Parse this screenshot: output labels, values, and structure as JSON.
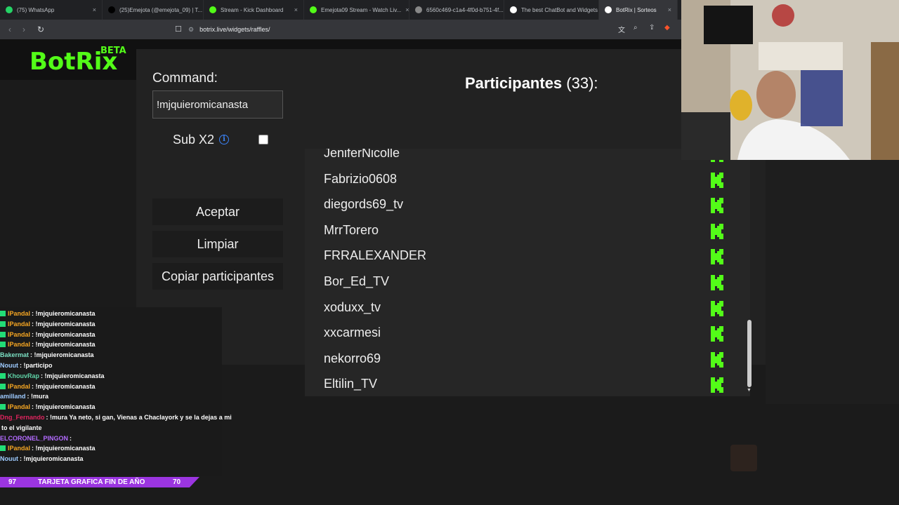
{
  "tabs": [
    {
      "label": "(75) WhatsApp",
      "color": "#25d366"
    },
    {
      "label": "(25)Emejota (@emejota_09) | T...",
      "color": "#000000"
    },
    {
      "label": "Stream - Kick Dashboard",
      "color": "#53fc18"
    },
    {
      "label": "Emejota09 Stream - Watch Liv...",
      "color": "#53fc18"
    },
    {
      "label": "6560c469-c1a4-4f0d-b751-4f...",
      "color": "#888888"
    },
    {
      "label": "The best ChatBot and Widgets",
      "color": "#ffffff"
    },
    {
      "label": "BotRix | Sorteos",
      "color": "#ffffff"
    }
  ],
  "address": {
    "url": "botrix.live/widgets/raffles/"
  },
  "site": {
    "logo": "BotRix",
    "beta": "BETA"
  },
  "form": {
    "command_label": "Command:",
    "command_value": "!mjquieromicanasta",
    "sub_label": "Sub X2",
    "sub_checked": false,
    "accept_label": "Aceptar",
    "clear_label": "Limpiar",
    "copy_label": "Copiar participantes"
  },
  "participants": {
    "title": "Participantes",
    "count": "(33):",
    "items": [
      "JeniferNicolle",
      "Fabrizio0608",
      "diegords69_tv",
      "MrrTorero",
      "FRRALEXANDER",
      "Bor_Ed_TV",
      "xoduxx_tv",
      "xxcarmesi",
      "nekorro69",
      "Eltilin_TV"
    ]
  },
  "chat": [
    {
      "user": "lPandal",
      "color": "#f5a623",
      "text": ": !mjquieromicanasta",
      "badge": true
    },
    {
      "user": "lPandal",
      "color": "#f5a623",
      "text": ": !mjquieromicanasta",
      "badge": true
    },
    {
      "user": "lPandal",
      "color": "#f5a623",
      "text": ": !mjquieromicanasta",
      "badge": true
    },
    {
      "user": "lPandal",
      "color": "#f5a623",
      "text": ": !mjquieromicanasta",
      "badge": true
    },
    {
      "user": "Bakermat",
      "color": "#7be0c3",
      "text": ": !mjquieromicanasta",
      "badge": false
    },
    {
      "user": "Nouut",
      "color": "#9ecbff",
      "text": ": !participo",
      "badge": false
    },
    {
      "user": "KhouvRap",
      "color": "#5fd3a7",
      "text": ": !mjquieromicanasta",
      "badge": true
    },
    {
      "user": "lPandal",
      "color": "#f5a623",
      "text": ": !mjquieromicanasta",
      "badge": true
    },
    {
      "user": "amilland",
      "color": "#9ecbff",
      "text": ": !mura",
      "badge": false
    },
    {
      "user": "lPandal",
      "color": "#f5a623",
      "text": ": !mjquieromicanasta",
      "badge": true
    },
    {
      "user": "Dng_Fernando",
      "color": "#e0245e",
      "text": ": !mura Ya neto, si gan, Vienas a Chaclayork y se la dejas a mi",
      "badge": false
    },
    {
      "user": "",
      "color": "#ffffff",
      "text": "to el vigilante",
      "badge": false
    },
    {
      "user": "ELCORONEL_PINGON",
      "color": "#b36bff",
      "text": ":",
      "badge": false
    },
    {
      "user": "lPandal",
      "color": "#f5a623",
      "text": ": !mjquieromicanasta",
      "badge": true
    },
    {
      "user": "Nouut",
      "color": "#9ecbff",
      "text": ": !mjquieromicanasta",
      "badge": false
    }
  ],
  "ticker": {
    "left": "97",
    "label": "TARJETA GRAFICA FIN DE AÑO",
    "right": "70"
  }
}
